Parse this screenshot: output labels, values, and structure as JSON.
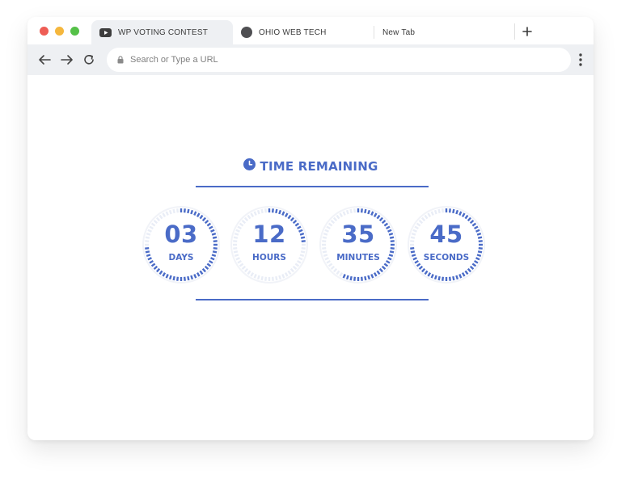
{
  "window": {
    "traffic_lights": {
      "close": "#ee5d55",
      "minimize": "#f5b73d",
      "zoom": "#55c148"
    }
  },
  "tabs": [
    {
      "label": "WP VOTING CONTEST",
      "icon": "youtube-icon",
      "active": true
    },
    {
      "label": "OHIO WEB TECH",
      "icon": "circle-favicon-icon",
      "active": false
    },
    {
      "label": "New Tab",
      "icon": "",
      "active": false
    }
  ],
  "toolbar": {
    "url_placeholder": "Search or Type a URL",
    "icons": [
      "back-arrow-icon",
      "forward-arrow-icon",
      "reload-icon",
      "lock-icon",
      "more-menu-icon"
    ]
  },
  "countdown": {
    "title": "TIME REMAINING",
    "title_icon": "clock-icon",
    "accent_color": "#4a6bc7",
    "ring_track_color": "#e9edf6",
    "units": [
      {
        "value": "03",
        "label": "DAYS",
        "progress": 0.75
      },
      {
        "value": "12",
        "label": "HOURS",
        "progress": 0.25
      },
      {
        "value": "35",
        "label": "MINUTES",
        "progress": 0.58
      },
      {
        "value": "45",
        "label": "SECONDS",
        "progress": 0.75
      }
    ]
  }
}
